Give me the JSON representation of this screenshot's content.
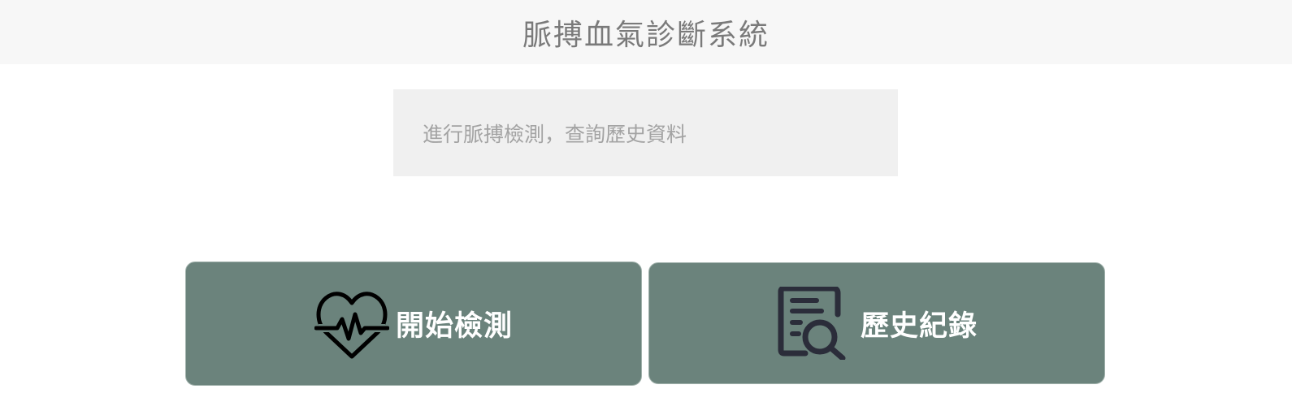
{
  "header": {
    "title": "脈搏血氣診斷系統"
  },
  "info": {
    "text": "進行脈搏檢測，查詢歷史資料"
  },
  "actions": {
    "start": {
      "label": "開始檢測",
      "icon": "heart-pulse-icon"
    },
    "history": {
      "label": "歷史紀錄",
      "icon": "document-search-icon"
    }
  },
  "colors": {
    "header_bg": "#f7f7f7",
    "info_bg": "#f0f0f0",
    "button_bg": "#6b837c",
    "button_text": "#ffffff",
    "icon_color": "#2b2d3a"
  }
}
